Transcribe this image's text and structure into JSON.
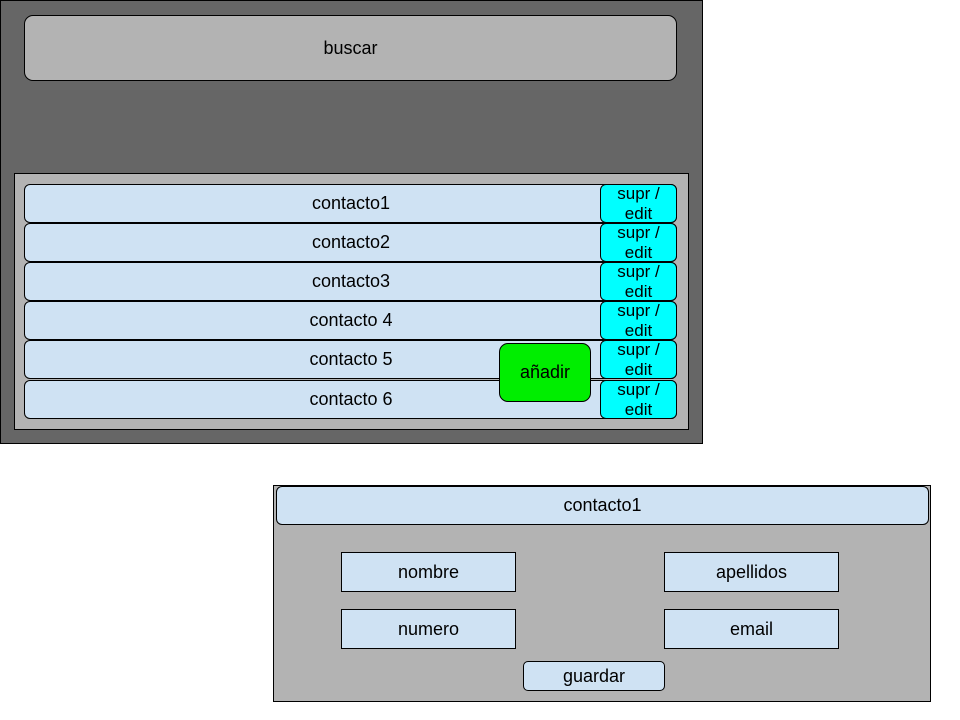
{
  "search": {
    "label": "buscar"
  },
  "contacts": [
    {
      "name": "contacto1",
      "action": [
        "supr /",
        "edit"
      ]
    },
    {
      "name": "contacto2",
      "action": [
        "supr /",
        "edit"
      ]
    },
    {
      "name": "contacto3",
      "action": [
        "supr /",
        "edit"
      ]
    },
    {
      "name": "contacto 4",
      "action": [
        "supr /",
        "edit"
      ]
    },
    {
      "name": "contacto 5",
      "action": [
        "supr /",
        "edit"
      ]
    },
    {
      "name": "contacto 6",
      "action": [
        "supr /",
        "edit"
      ]
    }
  ],
  "add_button": {
    "label": "añadir"
  },
  "detail": {
    "title": "contacto1",
    "fields": {
      "nombre": "nombre",
      "apellidos": "apellidos",
      "numero": "numero",
      "email": "email"
    },
    "save_label": "guardar"
  },
  "colors": {
    "frame_dark": "#666666",
    "panel_gray": "#b3b3b3",
    "row_blue": "#cfe2f3",
    "action_cyan": "#00ffff",
    "add_green": "#00ee00"
  }
}
